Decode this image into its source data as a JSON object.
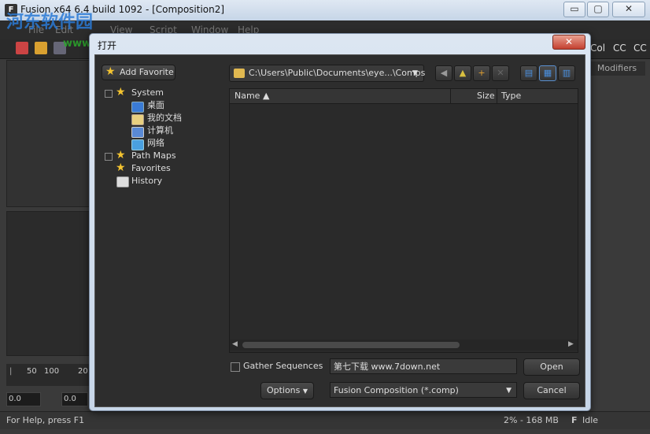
{
  "window": {
    "app_icon_label": "F",
    "title": "Fusion x64 6.4 build 1092 - [Composition2]",
    "minimize": "▭",
    "maximize": "▢",
    "close": "✕"
  },
  "watermark": {
    "brand": "河东软件园",
    "url": "www.pc0359.cn"
  },
  "menu": {
    "items": [
      "File",
      "Edit",
      "View",
      "Script",
      "Window",
      "Help"
    ]
  },
  "toolbar": {
    "right_tags": [
      "Col",
      "CC",
      "CC"
    ]
  },
  "modifiers_tab": "Modifiers",
  "ruler": {
    "ticks": [
      "50",
      "100",
      "20"
    ],
    "field_a": "0.0",
    "field_b": "0.0"
  },
  "status": {
    "help": "For Help, press F1",
    "memory": "2% - 168 MB",
    "logo": "F",
    "state": "Idle"
  },
  "dialog": {
    "title": "打开",
    "add_favorite": "Add Favorite",
    "tree": [
      {
        "label": "System",
        "icon": "star-icon"
      },
      {
        "label": "桌面",
        "icon": "desktop-icon"
      },
      {
        "label": "我的文档",
        "icon": "documents-icon"
      },
      {
        "label": "计算机",
        "icon": "computer-icon"
      },
      {
        "label": "网络",
        "icon": "network-icon"
      },
      {
        "label": "Path Maps",
        "icon": "star-icon"
      },
      {
        "label": "Favorites",
        "icon": "star-icon"
      },
      {
        "label": "History",
        "icon": "calendar-icon"
      }
    ],
    "path": "C:\\Users\\Public\\Documents\\eye...\\Comps",
    "columns": {
      "name": "Name ▲",
      "size": "Size",
      "type": "Type"
    },
    "gather_sequences": "Gather Sequences",
    "filename": "第七下载 www.7down.net",
    "open": "Open",
    "options": "Options",
    "filetype": "Fusion Composition (*.comp)",
    "cancel": "Cancel"
  }
}
